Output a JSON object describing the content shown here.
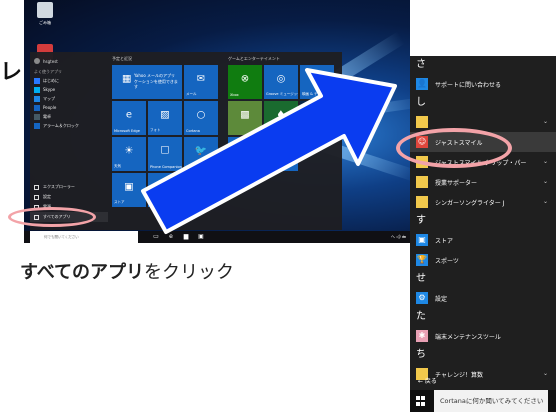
{
  "left_edge_text": "レ",
  "caption": {
    "bold": "すべてのアプリ",
    "rest": "をクリック"
  },
  "desktop": {
    "icons": [
      {
        "label": "ごみ箱",
        "icon": "recycle-bin-icon",
        "color": "#d0d8e0"
      },
      {
        "label": "",
        "icon": "app-shortcut-icon",
        "color": "#d33c3c"
      }
    ],
    "start_menu": {
      "user": "hsgtest",
      "recent_heading": "よく使うアプリ",
      "apps": [
        {
          "label": "はじめに",
          "color": "#2979ff"
        },
        {
          "label": "Skype",
          "color": "#00aff0"
        },
        {
          "label": "マップ",
          "color": "#1e88e5"
        },
        {
          "label": "People",
          "color": "#1565c0"
        },
        {
          "label": "電卓",
          "color": "#455a64"
        },
        {
          "label": "アラーム＆クロック",
          "color": "#1565c0"
        }
      ],
      "bottom": [
        {
          "label": "エクスプローラー"
        },
        {
          "label": "設定"
        },
        {
          "label": "電源"
        },
        {
          "label": "すべてのアプリ"
        }
      ],
      "group_a_title": "予定と近況",
      "group_b_title": "ゲームとエンターテイメント",
      "tiles_a": [
        {
          "label": "",
          "text": "Yahoo メールのアプリケーションを使用できます",
          "icon": "calendar-icon",
          "wide": true,
          "color": "#1565c0"
        },
        {
          "label": "メール",
          "text": "",
          "icon": "mail-icon",
          "wide": false,
          "color": "#1565c0"
        },
        {
          "label": "Microsoft Edge",
          "text": "",
          "icon": "edge-icon",
          "wide": false,
          "color": "#1565c0"
        },
        {
          "label": "フォト",
          "text": "",
          "icon": "photos-icon",
          "wide": false,
          "color": "#1565c0"
        },
        {
          "label": "Cortana",
          "text": "",
          "icon": "cortana-icon",
          "wide": false,
          "color": "#1565c0"
        },
        {
          "label": "天気",
          "text": "",
          "icon": "weather-icon",
          "wide": false,
          "color": "#1565c0"
        },
        {
          "label": "Phone Companion",
          "text": "",
          "icon": "phone-icon",
          "wide": false,
          "color": "#1565c0"
        },
        {
          "label": "Twitter",
          "text": "",
          "icon": "twitter-icon",
          "wide": false,
          "color": "#1565c0"
        },
        {
          "label": "ストア",
          "text": "",
          "icon": "store-icon",
          "wide": false,
          "color": "#1565c0"
        },
        {
          "label": "",
          "text": "",
          "icon": "skype-icon",
          "wide": false,
          "color": "#1565c0"
        }
      ],
      "tiles_b": [
        {
          "label": "Xbox",
          "icon": "xbox-icon",
          "color": "#107c10"
        },
        {
          "label": "Groove ミュージック",
          "icon": "groove-icon",
          "color": "#1565c0"
        },
        {
          "label": "映画 & テレビ",
          "icon": "film-icon",
          "color": "#1565c0"
        },
        {
          "label": "",
          "icon": "minecraft-icon",
          "color": "#5d8a3a"
        },
        {
          "label": "",
          "icon": "solitaire-icon",
          "color": "#1a6b2f"
        },
        {
          "label": "",
          "icon": "photoshop-icon",
          "color": "#0b2a4a"
        },
        {
          "label": "",
          "icon": "money-icon",
          "color": "#1565c0"
        },
        {
          "label": "",
          "icon": "news-icon",
          "color": "#1565c0"
        }
      ]
    },
    "taskbar_search": "何でも聞いてください",
    "taskbar_tray": "へ ◁) 🖮"
  },
  "all_apps": {
    "sections": [
      {
        "letter": "さ",
        "items": [
          {
            "label": "サポートに問い合わせる",
            "color": "#1e88e5",
            "icon": "support-icon",
            "chevron": false,
            "highlight": false
          }
        ]
      },
      {
        "letter": "し",
        "items": [
          {
            "label": "",
            "color": "#f2c94c",
            "icon": "folder-icon",
            "chevron": true,
            "highlight": false
          },
          {
            "label": "ジャストスマイル",
            "color": "#e0463c",
            "icon": "justsmile-icon",
            "chevron": false,
            "highlight": true
          },
          {
            "label": "ジャストスマイル クリップ・パー",
            "color": "#f2c94c",
            "icon": "folder-icon",
            "chevron": true,
            "highlight": false
          },
          {
            "label": "授業サポーター",
            "color": "#f2c94c",
            "icon": "folder-icon",
            "chevron": true,
            "highlight": false
          },
          {
            "label": "シンガーソングライター J",
            "color": "#f2c94c",
            "icon": "folder-icon",
            "chevron": true,
            "highlight": false
          }
        ]
      },
      {
        "letter": "す",
        "items": [
          {
            "label": "ストア",
            "color": "#1e88e5",
            "icon": "store-icon",
            "chevron": false,
            "highlight": false
          },
          {
            "label": "スポーツ",
            "color": "#1e88e5",
            "icon": "trophy-icon",
            "chevron": false,
            "highlight": false
          }
        ]
      },
      {
        "letter": "せ",
        "items": [
          {
            "label": "設定",
            "color": "#1e88e5",
            "icon": "gear-icon",
            "chevron": false,
            "highlight": false
          }
        ]
      },
      {
        "letter": "た",
        "items": [
          {
            "label": "端末メンテナンスツール",
            "color": "#e8a0b4",
            "icon": "maintenance-icon",
            "chevron": false,
            "highlight": false
          }
        ]
      },
      {
        "letter": "ち",
        "items": [
          {
            "label": "チャレンジ！算数",
            "color": "#f2c94c",
            "icon": "folder-icon",
            "chevron": true,
            "highlight": false
          }
        ]
      }
    ],
    "back_label": "← 戻る",
    "cortana_placeholder": "Cortanaに何か聞いてみてください"
  },
  "colors": {
    "arrow_fill": "#0a3cf0",
    "arrow_outline": "#ffffff",
    "highlight_ellipse": "#f3a3a8"
  }
}
